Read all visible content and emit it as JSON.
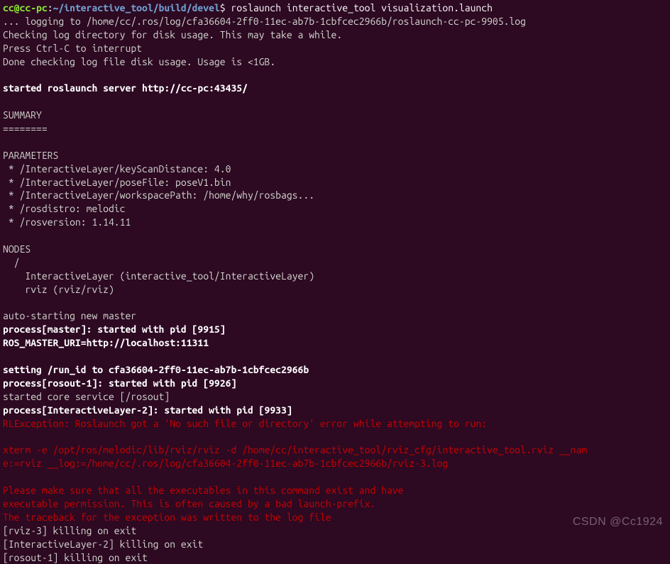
{
  "prompt": {
    "user": "cc@cc-pc",
    "sep1": ":",
    "path": "~/interactive_tool/build/devel",
    "sep2": "$ ",
    "command": "roslaunch interactive_tool visualization.launch"
  },
  "lines": {
    "l01": "... logging to /home/cc/.ros/log/cfa36604-2ff0-11ec-ab7b-1cbfcec2966b/roslaunch-cc-pc-9905.log",
    "l02": "Checking log directory for disk usage. This may take a while.",
    "l03": "Press Ctrl-C to interrupt",
    "l04": "Done checking log file disk usage. Usage is <1GB.",
    "l05": "",
    "l06": "started roslaunch server http://cc-pc:43435/",
    "l07": "",
    "l08": "SUMMARY",
    "l09": "========",
    "l10": "",
    "l11": "PARAMETERS",
    "l12": " * /InteractiveLayer/keyScanDistance: 4.0",
    "l13": " * /InteractiveLayer/poseFile: poseV1.bin",
    "l14": " * /InteractiveLayer/workspacePath: /home/why/rosbags...",
    "l15": " * /rosdistro: melodic",
    "l16": " * /rosversion: 1.14.11",
    "l17": "",
    "l18": "NODES",
    "l19": "  /",
    "l20": "    InteractiveLayer (interactive_tool/InteractiveLayer)",
    "l21": "    rviz (rviz/rviz)",
    "l22": "",
    "l23": "auto-starting new master",
    "l24": "process[master]: started with pid [9915]",
    "l25": "ROS_MASTER_URI=http://localhost:11311",
    "l26": "",
    "l27": "setting /run_id to cfa36604-2ff0-11ec-ab7b-1cbfcec2966b",
    "l28": "process[rosout-1]: started with pid [9926]",
    "l29": "started core service [/rosout]",
    "l30": "process[InteractiveLayer-2]: started with pid [9933]",
    "l31": "RLException: Roslaunch got a 'No such file or directory' error while attempting to run:",
    "l32": "",
    "l33": "xterm -e /opt/ros/melodic/lib/rviz/rviz -d /home/cc/interactive_tool/rviz_cfg/interactive_tool.rviz __nam",
    "l34": "e:=rviz __log:=/home/cc/.ros/log/cfa36604-2ff0-11ec-ab7b-1cbfcec2966b/rviz-3.log",
    "l35": "",
    "l36": "Please make sure that all the executables in this command exist and have",
    "l37": "executable permission. This is often caused by a bad launch-prefix.",
    "l38": "The traceback for the exception was written to the log file",
    "l39": "[rviz-3] killing on exit",
    "l40": "[InteractiveLayer-2] killing on exit",
    "l41": "[rosout-1] killing on exit"
  },
  "watermark": "CSDN @Cc1924"
}
